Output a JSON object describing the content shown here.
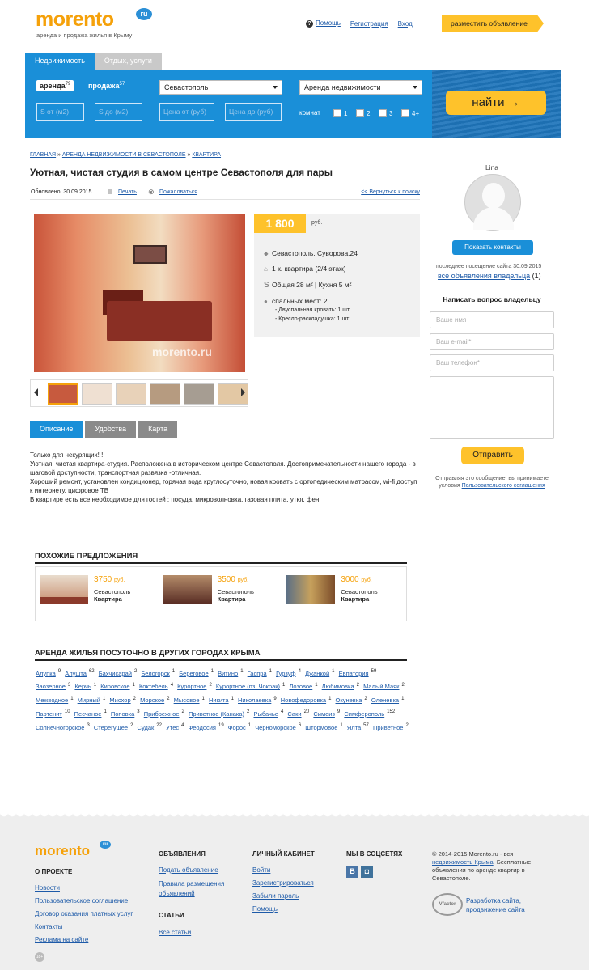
{
  "logo": {
    "word": "morento",
    "ru": "ru",
    "tagline": "аренда и продажа жилья в Крыму"
  },
  "toplinks": {
    "help": "Помощь",
    "register": "Регистрация",
    "login": "Вход"
  },
  "post_ad": "разместить объявление",
  "tabs": [
    "Недвижимость",
    "Отдых, услуги"
  ],
  "search": {
    "rent": "аренда",
    "rent_count": "79",
    "sale": "продажа",
    "sale_count": "57",
    "city": "Севастополь",
    "type": "Аренда недвижимости",
    "s_from": "S от (м2)",
    "s_to": "S до (м2)",
    "price_from": "Цена от (руб)",
    "price_to": "Цена до (руб)",
    "rooms_label": "комнат",
    "rooms": [
      "1",
      "2",
      "3",
      "4+"
    ],
    "find": "найти →"
  },
  "breadcrumb": [
    "ГЛАВНАЯ",
    "АРЕНДА НЕДВИЖИМОСТИ В СЕВАСТОПОЛЕ",
    "КВАРТИРА"
  ],
  "title": "Уютная, чистая студия в самом центре Севастополя для пары",
  "meta": {
    "updated": "Обновлено: 30.09.2015",
    "print": "Печать",
    "complain": "Пожаловаться",
    "back": "<< Вернуться к поиску"
  },
  "photo_watermark": "morento.ru",
  "price": {
    "value": "1 800",
    "unit": "руб."
  },
  "details": {
    "address": "Севастополь, Суворова,24",
    "rooms": "1 к. квартира (2/4 этаж)",
    "area": "Общая 28 м² | Кухня 5 м²",
    "beds": "спальных мест: 2",
    "bed1": "- Двуспальная кровать: 1 шт.",
    "bed2": "- Кресло-раскладушка: 1 шт."
  },
  "detail_tabs": [
    "Описание",
    "Удобства",
    "Карта"
  ],
  "description": [
    "Только для некурящих! !",
    "Уютная, чистая квартира-студия. Расположена в историческом центре Севастополя. Достопримечательности нашего города - в шаговой доступности, транспортная развязка -отличная.",
    "Хороший ремонт, установлен кондиционер, горячая вода круглосуточно, новая кровать с ортопедическим матрасом, wi-fi доступ к интернету, цифровое ТВ",
    "В квартире есть все необходимое для гостей : посуда, микроволновка, газовая плита, утюг, фен."
  ],
  "owner": {
    "name": "Lina",
    "show_contacts": "Показать контакты",
    "last_visit": "последнее посещение сайта 30.09.2015",
    "all_ads": "все объявления владельца",
    "all_ads_count": "(1)",
    "ask_title": "Написать вопрос владельцу",
    "name_ph": "Ваше имя",
    "email_ph": "Ваш e-mail*",
    "phone_ph": "Ваш телефон*",
    "send": "Отправить",
    "agree1": "Отправляя это сообщение, вы принимаете",
    "agree2": "условия",
    "agree_link": "Пользовательского соглашения"
  },
  "similar": {
    "title": "ПОХОЖИЕ ПРЕДЛОЖЕНИЯ",
    "items": [
      {
        "price": "3750",
        "unit": "руб.",
        "city": "Севастополь",
        "type": "Квартира"
      },
      {
        "price": "3500",
        "unit": "руб.",
        "city": "Севастополь",
        "type": "Квартира"
      },
      {
        "price": "3000",
        "unit": "руб.",
        "city": "Севастополь",
        "type": "Квартира"
      }
    ]
  },
  "cities_title": "АРЕНДА ЖИЛЬЯ ПОСУТОЧНО В ДРУГИХ ГОРОДАХ КРЫМА",
  "cities": [
    [
      "Алупка",
      "9"
    ],
    [
      "Алушта",
      "62"
    ],
    [
      "Бахчисарай",
      "2"
    ],
    [
      "Белогорск",
      "1"
    ],
    [
      "Береговое",
      "1"
    ],
    [
      "Витино",
      "1"
    ],
    [
      "Гаспра",
      "1"
    ],
    [
      "Гурзуф",
      "4"
    ],
    [
      "Джанкой",
      "1"
    ],
    [
      "Евпатория",
      "59"
    ],
    [
      "Заозерное",
      "3"
    ],
    [
      "Керчь",
      "1"
    ],
    [
      "Кировское",
      "1"
    ],
    [
      "Коктебель",
      "4"
    ],
    [
      "Курортное",
      "2"
    ],
    [
      "Курортное (пз. Чокрак)",
      "1"
    ],
    [
      "Лозовое",
      "1"
    ],
    [
      "Любимовка",
      "2"
    ],
    [
      "Малый Маяк",
      "2"
    ],
    [
      "Межводное",
      "1"
    ],
    [
      "Мирный",
      "1"
    ],
    [
      "Мисхор",
      "2"
    ],
    [
      "Морское",
      "2"
    ],
    [
      "Мысовое",
      "1"
    ],
    [
      "Никита",
      "1"
    ],
    [
      "Николаевка",
      "9"
    ],
    [
      "Новофедоровка",
      "1"
    ],
    [
      "Окуневка",
      "2"
    ],
    [
      "Оленевка",
      "1"
    ],
    [
      "Партенит",
      "10"
    ],
    [
      "Песчаное",
      "1"
    ],
    [
      "Поповка",
      "3"
    ],
    [
      "Прибрежное",
      "2"
    ],
    [
      "Приветное (Канака)",
      "2"
    ],
    [
      "Рыбачье",
      "4"
    ],
    [
      "Саки",
      "20"
    ],
    [
      "Симеиз",
      "9"
    ],
    [
      "Симферополь",
      "152"
    ],
    [
      "Солнечногорское",
      "3"
    ],
    [
      "Стерегущее",
      "2"
    ],
    [
      "Судак",
      "22"
    ],
    [
      "Утес",
      "4"
    ],
    [
      "Феодосия",
      "19"
    ],
    [
      "Форос",
      "1"
    ],
    [
      "Черноморское",
      "6"
    ],
    [
      "Штормовое",
      "1"
    ],
    [
      "Ялта",
      "57"
    ],
    [
      "Приветное",
      "2"
    ]
  ],
  "footer": {
    "about": "О ПРОЕКТЕ",
    "about_links": [
      "Новости",
      "Пользовательское соглашение",
      "Договор оказания платных услуг",
      "Контакты",
      "Реклама на сайте"
    ],
    "ads": "ОБЪЯВЛЕНИЯ",
    "ads_links": [
      "Подать объявление",
      "Правила размещения объявлений"
    ],
    "articles": "СТАТЬИ",
    "articles_links": [
      "Все статьи"
    ],
    "cabinet": "ЛИЧНЫЙ КАБИНЕТ",
    "cabinet_links": [
      "Войти",
      "Зарегистрироваться",
      "Забыли пароль",
      "Помощь"
    ],
    "social": "МЫ В СОЦСЕТЯХ",
    "copy1": "© 2014-2015 Morento.ru - вся",
    "copy_link": "недвижимость Крыма",
    "copy2": ". Бесплатные объявления по аренде квартир в Севастополе.",
    "dev": "Разработка сайта, продвижение сайта",
    "age": "18+"
  }
}
